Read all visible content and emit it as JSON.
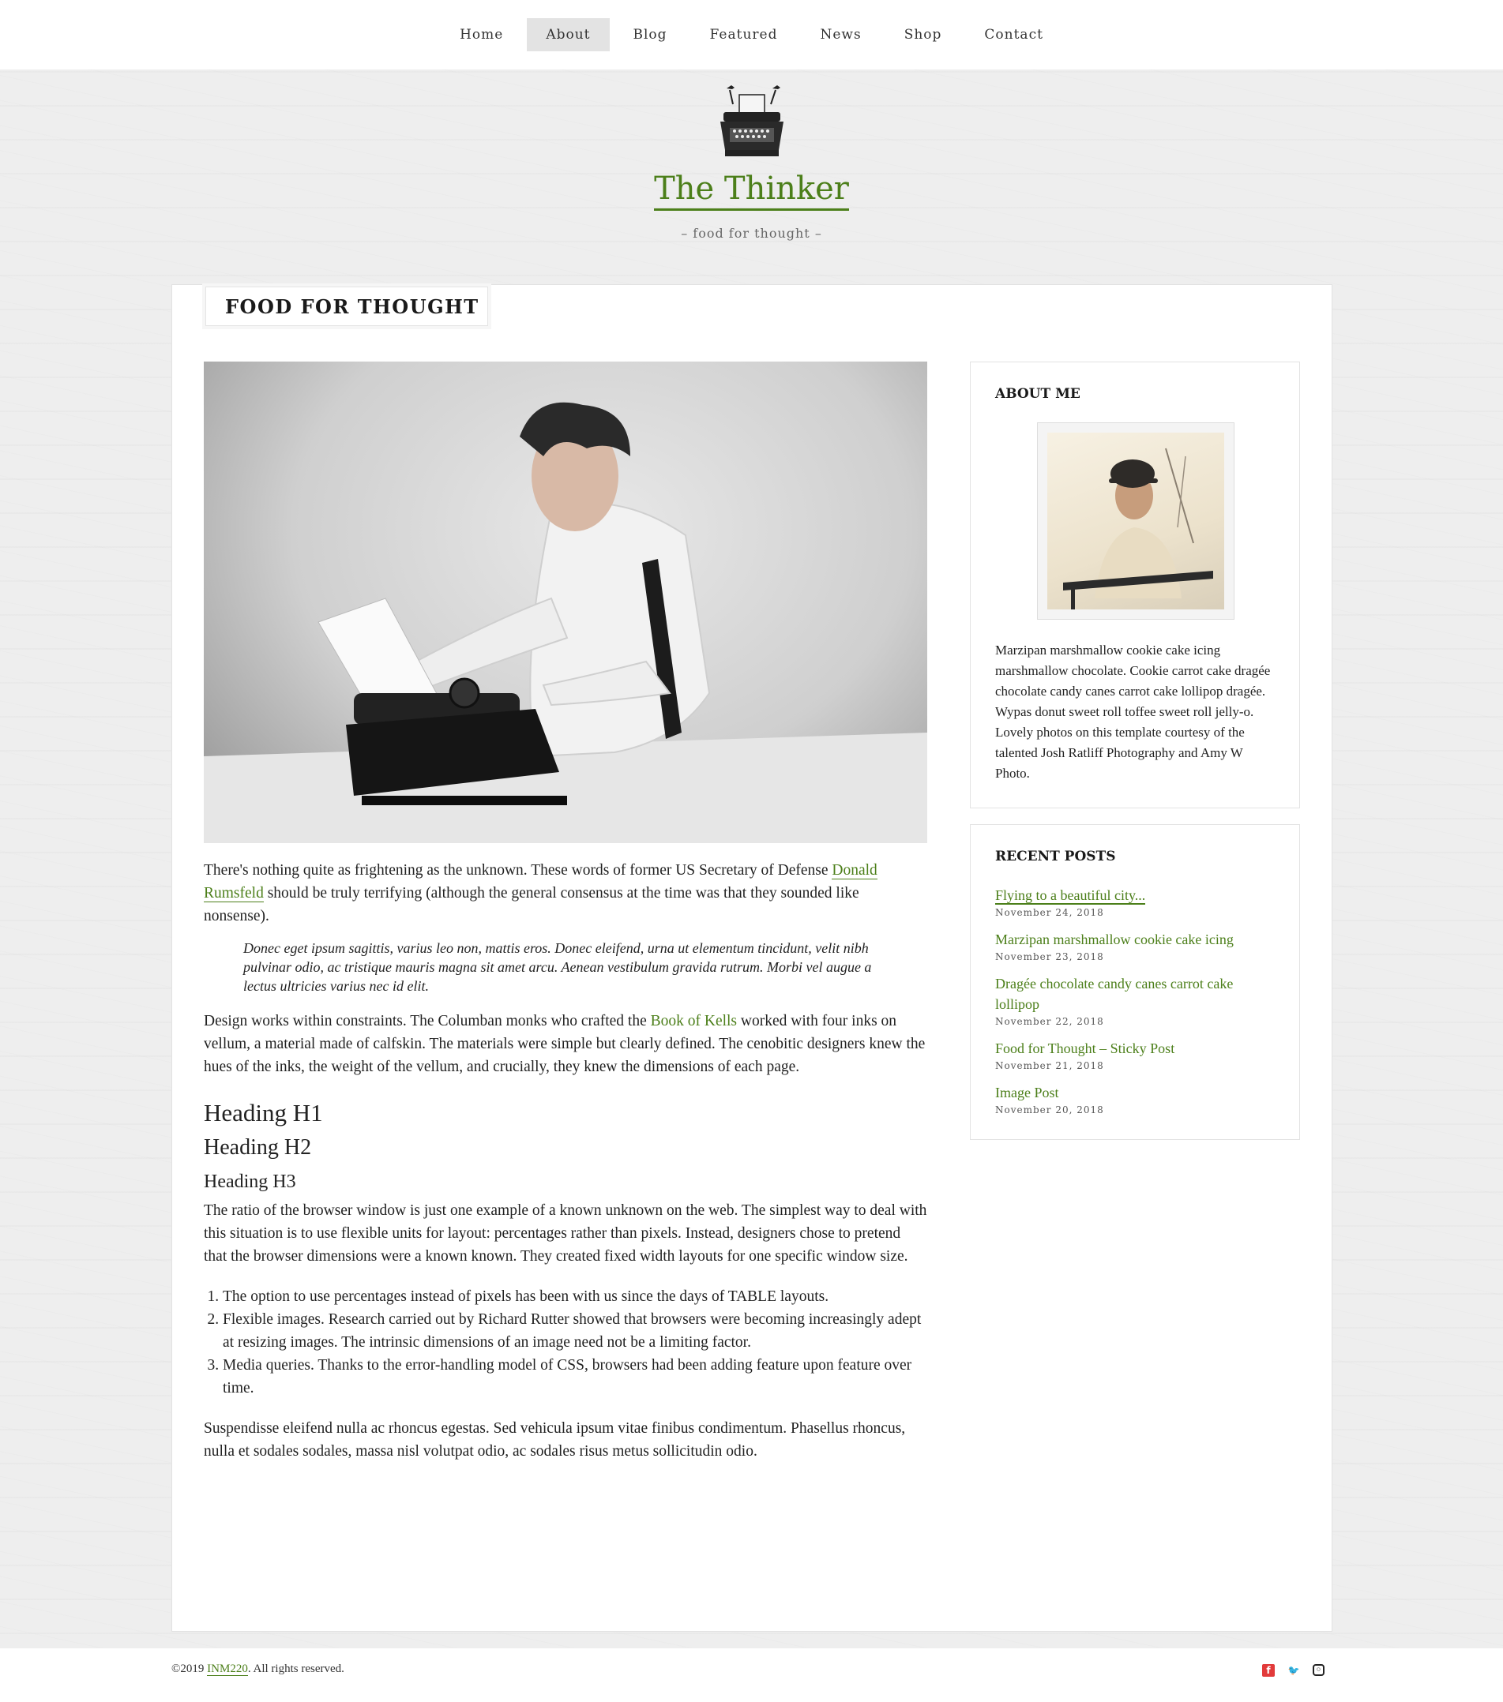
{
  "nav": {
    "items": [
      {
        "label": "Home",
        "active": false
      },
      {
        "label": "About",
        "active": true
      },
      {
        "label": "Blog",
        "active": false
      },
      {
        "label": "Featured",
        "active": false
      },
      {
        "label": "News",
        "active": false
      },
      {
        "label": "Shop",
        "active": false
      },
      {
        "label": "Contact",
        "active": false
      }
    ]
  },
  "header": {
    "logo_icon": "typewriter-with-birds-icon",
    "title": "The Thinker",
    "tagline": "– food for thought –"
  },
  "page": {
    "heading": "FOOD FOR THOUGHT",
    "hero_image": "man-at-typewriter-photo",
    "intro_before": "There's nothing quite as frightening as the unknown. These words of former US Secretary of Defense ",
    "intro_link": "Donald Rumsfeld",
    "intro_after": " should be truly terrifying (although the general consensus at the time was that they sounded like nonsense).",
    "quote": "Donec eget ipsum sagittis, varius leo non, mattis eros. Donec eleifend, urna ut elementum tincidunt, velit nibh pulvinar odio, ac tristique mauris magna sit amet arcu. Aenean vestibulum gravida rutrum. Morbi vel augue a lectus ultricies varius nec id elit.",
    "para2_before": "Design works within constraints. The Columban monks who crafted the ",
    "para2_link": "Book of Kells",
    "para2_after": " worked with four inks on vellum, a material made of calfskin. The materials were simple but clearly defined. The cenobitic designers knew the hues of the inks, the weight of the vellum, and crucially, they knew the dimensions of each page.",
    "h1": "Heading H1",
    "h2": "Heading H2",
    "h3": "Heading H3",
    "para3": "The ratio of the browser window is just one example of a known unknown on the web. The simplest way to deal with this situation is to use flexible units for layout: percentages rather than pixels. Instead, designers chose to pretend that the browser dimensions were a known known. They created fixed width layouts for one specific window size.",
    "list": [
      "The option to use percentages instead of pixels has been with us since the days of TABLE layouts.",
      "Flexible images. Research carried out by Richard Rutter showed that browsers were becoming increasingly adept at resizing images. The intrinsic dimensions of an image need not be a limiting factor.",
      "Media queries. Thanks to the error-handling model of CSS, browsers had been adding feature upon feature over time."
    ],
    "para4": "Suspendisse eleifend nulla ac rhoncus egestas. Sed vehicula ipsum vitae finibus condimentum. Phasellus rhoncus, nulla et sodales sodales, massa nisl volutpat odio, ac sodales risus metus sollicitudin odio."
  },
  "sidebar": {
    "about": {
      "title": "ABOUT ME",
      "avatar": "man-with-hat-photo",
      "text": "Marzipan marshmallow cookie cake icing marshmallow chocolate. Cookie carrot cake dragée chocolate candy canes carrot cake lollipop dragée. Wypas donut sweet roll toffee sweet roll jelly-o. Lovely photos on this template courtesy of the talented Josh Ratliff Photography and Amy W Photo."
    },
    "recent": {
      "title": "RECENT POSTS",
      "posts": [
        {
          "title": "Flying to a beautiful city...",
          "date": "November 24, 2018"
        },
        {
          "title": "Marzipan marshmallow cookie cake icing",
          "date": "November 23, 2018"
        },
        {
          "title": "Dragée chocolate candy canes carrot cake lollipop",
          "date": "November 22, 2018"
        },
        {
          "title": "Food for Thought – Sticky Post",
          "date": "November 21, 2018"
        },
        {
          "title": "Image Post",
          "date": "November 20, 2018"
        }
      ]
    }
  },
  "footer": {
    "copyright_prefix": "©2019 ",
    "copyright_link": "INM220",
    "copyright_suffix": ". All rights reserved.",
    "social": [
      "facebook-icon",
      "twitter-icon",
      "instagram-icon"
    ]
  },
  "colors": {
    "accent": "#4c7f1a",
    "nav_active_bg": "#e3e3e3",
    "background": "#eeeeee"
  }
}
